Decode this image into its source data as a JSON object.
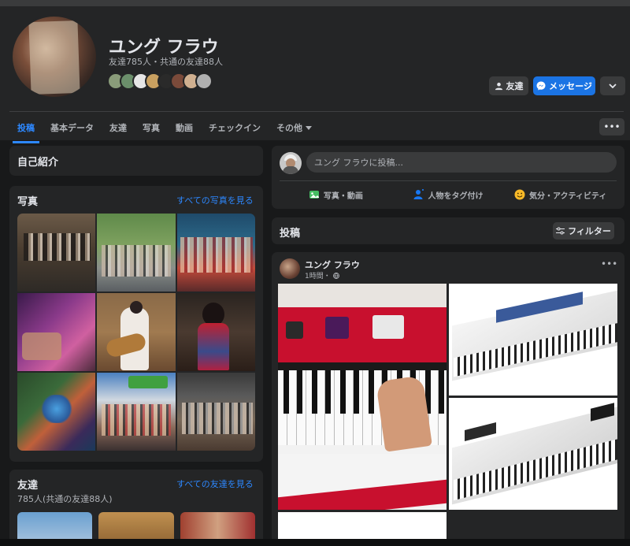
{
  "profile": {
    "name": "ユング フラウ",
    "friends_summary": "友達785人・共通の友達88人",
    "face_colors": [
      "#8a9c7a",
      "#6b8f6b",
      "#e6e6e6",
      "#c9a060",
      "#2a2a2a",
      "#7a4a3a",
      "#d0b090",
      "#b0b0b0"
    ]
  },
  "actions": {
    "friend_label": "友達",
    "message_label": "メッセージ"
  },
  "tabs": [
    {
      "label": "投稿"
    },
    {
      "label": "基本データ"
    },
    {
      "label": "友達"
    },
    {
      "label": "写真"
    },
    {
      "label": "動画"
    },
    {
      "label": "チェックイン"
    },
    {
      "label": "その他"
    }
  ],
  "intro": {
    "title": "自己紹介"
  },
  "photos": {
    "title": "写真",
    "see_all": "すべての写真を見る"
  },
  "friends": {
    "title": "友達",
    "count": "785人(共通の友達88人)",
    "see_all": "すべての友達を見る"
  },
  "composer": {
    "placeholder": "ユング フラウに投稿...",
    "photo_video": "写真・動画",
    "tag_people": "人物をタグ付け",
    "feeling": "気分・アクティビティ"
  },
  "posts": {
    "title": "投稿",
    "filter_label": "フィルター"
  },
  "post": {
    "author": "ユング フラウ",
    "time": "1時間・"
  },
  "colors": {
    "accent": "#2d88ff",
    "message_button": "#1b74e4",
    "card_bg": "#242526",
    "page_bg": "#18191a"
  }
}
